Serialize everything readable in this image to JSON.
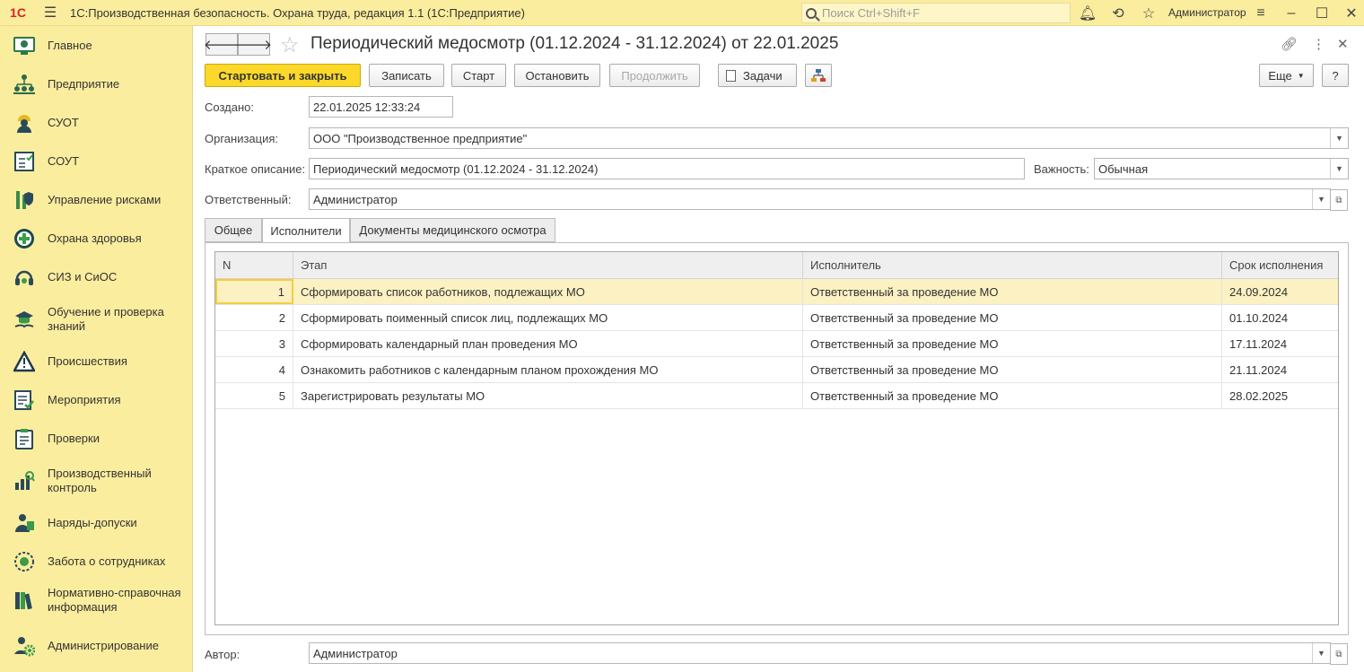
{
  "app": {
    "logo": "1С",
    "title": "1С:Производственная безопасность. Охрана труда, редакция 1.1  (1С:Предприятие)",
    "search_placeholder": "Поиск Ctrl+Shift+F",
    "user": "Администратор"
  },
  "sidebar": {
    "items": [
      {
        "label": "Главное",
        "icon": "home-icon"
      },
      {
        "label": "Предприятие",
        "icon": "org-structure-icon"
      },
      {
        "label": "СУОТ",
        "icon": "worker-helmet-icon"
      },
      {
        "label": "СОУТ",
        "icon": "checklist-icon"
      },
      {
        "label": "Управление рисками",
        "icon": "risk-shield-icon"
      },
      {
        "label": "Охрана здоровья",
        "icon": "health-cross-icon"
      },
      {
        "label": "СИЗ и СиОС",
        "icon": "protective-gear-icon"
      },
      {
        "label": "Обучение и проверка знаний",
        "icon": "training-icon"
      },
      {
        "label": "Происшествия",
        "icon": "warning-icon"
      },
      {
        "label": "Мероприятия",
        "icon": "tasks-icon"
      },
      {
        "label": "Проверки",
        "icon": "clipboard-icon"
      },
      {
        "label": "Производственный контроль",
        "icon": "production-control-icon"
      },
      {
        "label": "Наряды-допуски",
        "icon": "permit-icon"
      },
      {
        "label": "Забота о сотрудниках",
        "icon": "care-icon"
      },
      {
        "label": "Нормативно-справочная информация",
        "icon": "reference-books-icon"
      },
      {
        "label": "Администрирование",
        "icon": "admin-gear-icon"
      }
    ]
  },
  "document": {
    "title": "Периодический медосмотр (01.12.2024 - 31.12.2024)  от 22.01.2025"
  },
  "toolbar": {
    "start_close": "Стартовать и закрыть",
    "save": "Записать",
    "start": "Старт",
    "stop": "Остановить",
    "continue": "Продолжить",
    "tasks": "Задачи",
    "more": "Еще",
    "help": "?"
  },
  "form": {
    "created_label": "Создано:",
    "created_value": "22.01.2025 12:33:24",
    "org_label": "Организация:",
    "org_value": "ООО \"Производственное предприятие\"",
    "desc_label": "Краткое описание:",
    "desc_value": "Периодический медосмотр (01.12.2024 - 31.12.2024)",
    "importance_label": "Важность:",
    "importance_value": "Обычная",
    "responsible_label": "Ответственный:",
    "responsible_value": "Администратор",
    "author_label": "Автор:",
    "author_value": "Администратор"
  },
  "tabs": [
    {
      "label": "Общее",
      "active": false
    },
    {
      "label": "Исполнители",
      "active": true
    },
    {
      "label": "Документы медицинского осмотра",
      "active": false
    }
  ],
  "table": {
    "columns": [
      "N",
      "Этап",
      "Исполнитель",
      "Срок исполнения"
    ],
    "rows": [
      {
        "n": "1",
        "stage": "Сформировать список работников, подлежащих МО",
        "executor": "Ответственный за проведение МО",
        "due": "24.09.2024"
      },
      {
        "n": "2",
        "stage": "Сформировать поименный список лиц, подлежащих МО",
        "executor": "Ответственный за проведение МО",
        "due": "01.10.2024"
      },
      {
        "n": "3",
        "stage": "Сформировать календарный план проведения МО",
        "executor": "Ответственный за проведение МО",
        "due": "17.11.2024"
      },
      {
        "n": "4",
        "stage": "Ознакомить работников с календарным планом прохождения МО",
        "executor": "Ответственный за проведение МО",
        "due": "21.11.2024"
      },
      {
        "n": "5",
        "stage": "Зарегистрировать результаты МО",
        "executor": "Ответственный за проведение МО",
        "due": "28.02.2025"
      }
    ]
  },
  "colors": {
    "accent": "#fbd829",
    "sidebar_bg": "#fbed9e",
    "selection": "#fbf1c2"
  }
}
